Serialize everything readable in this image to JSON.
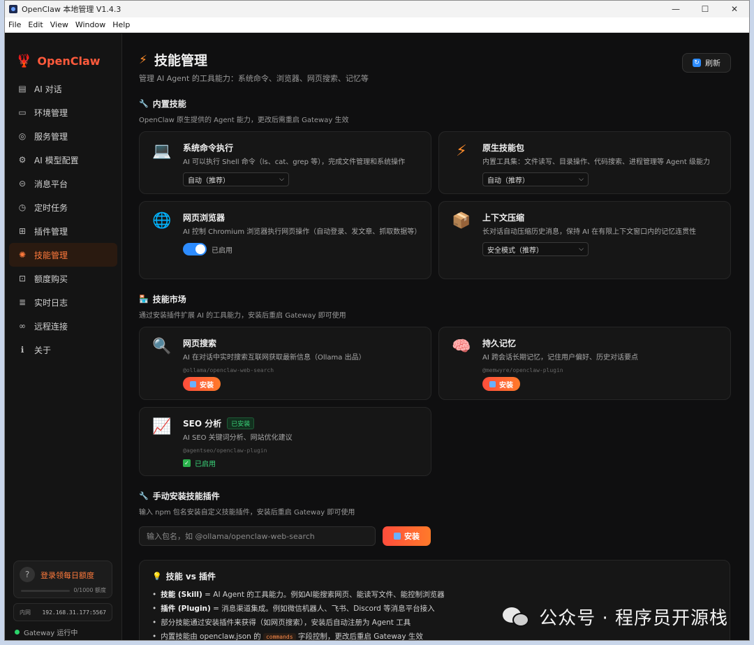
{
  "window": {
    "title": "OpenClaw 本地管理 V1.4.3",
    "controls": [
      "—",
      "☐",
      "✕"
    ]
  },
  "menu": [
    "File",
    "Edit",
    "View",
    "Window",
    "Help"
  ],
  "brand": {
    "name": "OpenClaw",
    "logo_icon": "lobster-icon"
  },
  "nav": [
    {
      "label": "AI 对话",
      "icon": "▤",
      "icon_name": "chat-icon",
      "active": false
    },
    {
      "label": "环境管理",
      "icon": "▭",
      "icon_name": "monitor-icon",
      "active": false
    },
    {
      "label": "服务管理",
      "icon": "◎",
      "icon_name": "service-icon",
      "active": false
    },
    {
      "label": "AI 模型配置",
      "icon": "⚙",
      "icon_name": "gear-icon",
      "active": false
    },
    {
      "label": "消息平台",
      "icon": "⊝",
      "icon_name": "link-icon",
      "active": false
    },
    {
      "label": "定时任务",
      "icon": "◷",
      "icon_name": "timer-icon",
      "active": false
    },
    {
      "label": "插件管理",
      "icon": "⊞",
      "icon_name": "plugin-icon",
      "active": false
    },
    {
      "label": "技能管理",
      "icon": "✺",
      "icon_name": "skill-icon",
      "active": true
    },
    {
      "label": "额度购买",
      "icon": "⊡",
      "icon_name": "cart-icon",
      "active": false
    },
    {
      "label": "实时日志",
      "icon": "≣",
      "icon_name": "log-icon",
      "active": false
    },
    {
      "label": "远程连接",
      "icon": "∞",
      "icon_name": "remote-icon",
      "active": false
    },
    {
      "label": "关于",
      "icon": "ℹ",
      "icon_name": "info-icon",
      "active": false
    }
  ],
  "sidebar_footer": {
    "quota_icon": "?",
    "quota_label": "登录领每日额度",
    "quota_count": "0/1000 额度",
    "quota_used": 0,
    "quota_total": 1000,
    "ip_label": "内网",
    "ip_value": "192.168.31.177:5567",
    "gateway_status": "Gateway 运行中"
  },
  "page": {
    "icon": "⚡",
    "title": "技能管理",
    "subtitle": "管理 AI Agent 的工具能力：系统命令、浏览器、网页搜索、记忆等",
    "refresh_label": "刷新"
  },
  "builtin": {
    "title": "内置技能",
    "title_icon": "🔧",
    "subtitle": "OpenClaw 原生提供的 Agent 能力，更改后需重启 Gateway 生效",
    "cards": [
      {
        "icon": "💻",
        "icon_name": "laptop-icon",
        "title": "系统命令执行",
        "desc": "AI 可以执行 Shell 命令（ls、cat、grep 等），完成文件管理和系统操作",
        "select": "自动（推荐）"
      },
      {
        "icon": "⚡",
        "icon_name": "bolt-icon",
        "title": "原生技能包",
        "desc": "内置工具集：文件读写、目录操作、代码搜索、进程管理等 Agent 级能力",
        "select": "自动（推荐）"
      },
      {
        "icon": "🌐",
        "icon_name": "globe-icon",
        "title": "网页浏览器",
        "desc": "AI 控制 Chromium 浏览器执行网页操作（自动登录、发文章、抓取数据等）",
        "toggle_label": "已启用",
        "toggle_on": true
      },
      {
        "icon": "📦",
        "icon_name": "box-icon",
        "title": "上下文压缩",
        "desc": "长对话自动压缩历史消息，保持 AI 在有限上下文窗口内的记忆连贯性",
        "select": "安全模式（推荐）"
      }
    ]
  },
  "market": {
    "title": "技能市场",
    "title_icon": "🏪",
    "subtitle": "通过安装插件扩展 AI 的工具能力，安装后重启 Gateway 即可使用",
    "cards": [
      {
        "icon": "🔍",
        "icon_name": "search-icon",
        "title": "网页搜索",
        "desc": "AI 在对话中实时搜索互联网获取最新信息（Ollama 出品）",
        "pkg": "@ollama/openclaw-web-search",
        "button": "安装"
      },
      {
        "icon": "🧠",
        "icon_name": "brain-icon",
        "title": "持久记忆",
        "desc": "AI 跨会话长期记忆，记住用户偏好、历史对话要点",
        "pkg": "@memwyre/openclaw-plugin",
        "button": "安装"
      },
      {
        "icon": "📈",
        "icon_name": "chart-icon",
        "title": "SEO 分析",
        "badge": "已安装",
        "desc": "AI SEO 关键词分析、网站优化建议",
        "pkg": "@agentseo/openclaw-plugin",
        "enabled_label": "已启用"
      }
    ]
  },
  "manual": {
    "title": "手动安装技能插件",
    "title_icon": "🔧",
    "subtitle": "输入 npm 包名安装自定义技能插件，安装后重启 Gateway 即可使用",
    "input_value": "",
    "input_placeholder": "输入包名，如 @ollama/openclaw-web-search",
    "button": "安装"
  },
  "info": {
    "title": "技能 vs 插件",
    "title_icon": "💡",
    "items": [
      {
        "bold": "技能 (Skill)",
        "text": " = AI Agent 的工具能力。例如AI能搜索网页、能读写文件、能控制浏览器"
      },
      {
        "bold": "插件 (Plugin)",
        "text": " = 消息渠道集成。例如微信机器人、飞书、Discord 等消息平台接入"
      },
      {
        "bold": "",
        "text": "部分技能通过安装插件来获得（如网页搜索），安装后自动注册为 Agent 工具"
      },
      {
        "bold": "",
        "text_before": "内置技能由 openclaw.json 的 ",
        "code": "commands",
        "text_after": " 字段控制，更改后重启 Gateway 生效"
      }
    ]
  },
  "watermark": {
    "text": "公众号 · 程序员开源栈",
    "icon": "wechat-icon"
  }
}
